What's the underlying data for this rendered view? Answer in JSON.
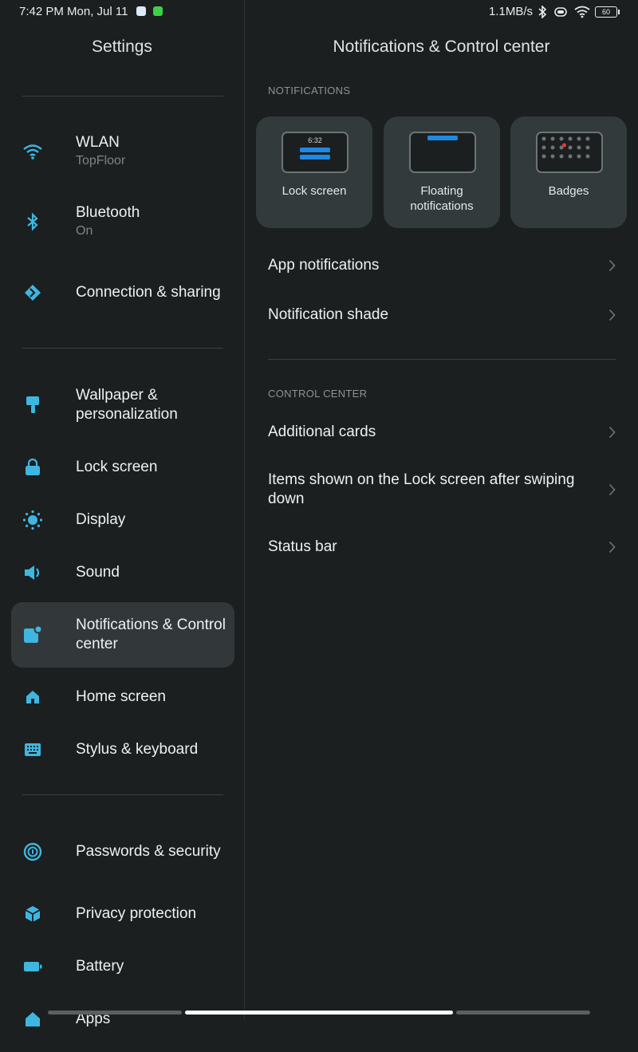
{
  "status_bar": {
    "time": "7:42 PM Mon, Jul 11",
    "network_speed": "1.1MB/s",
    "battery_level": "60"
  },
  "left_pane": {
    "title": "Settings",
    "items": [
      {
        "label": "WLAN",
        "sub": "TopFloor",
        "icon": "wifi-icon"
      },
      {
        "label": "Bluetooth",
        "sub": "On",
        "icon": "bluetooth-icon"
      },
      {
        "label": "Connection & sharing",
        "sub": "",
        "icon": "connection-icon"
      },
      {
        "label": "Wallpaper & personalization",
        "sub": "",
        "icon": "paintbrush-icon"
      },
      {
        "label": "Lock screen",
        "sub": "",
        "icon": "lock-icon"
      },
      {
        "label": "Display",
        "sub": "",
        "icon": "brightness-icon"
      },
      {
        "label": "Sound",
        "sub": "",
        "icon": "speaker-icon"
      },
      {
        "label": "Notifications & Control center",
        "sub": "",
        "icon": "notification-icon"
      },
      {
        "label": "Home screen",
        "sub": "",
        "icon": "home-icon"
      },
      {
        "label": "Stylus & keyboard",
        "sub": "",
        "icon": "keyboard-icon"
      },
      {
        "label": "Passwords & security",
        "sub": "",
        "icon": "fingerprint-icon"
      },
      {
        "label": "Privacy protection",
        "sub": "",
        "icon": "privacy-icon"
      },
      {
        "label": "Battery",
        "sub": "",
        "icon": "battery-icon"
      },
      {
        "label": "Apps",
        "sub": "",
        "icon": "apps-icon"
      }
    ]
  },
  "right_pane": {
    "title": "Notifications & Control center",
    "notifications_header": "NOTIFICATIONS",
    "cards": [
      {
        "label": "Lock screen",
        "preview_time": "6:32"
      },
      {
        "label": "Floating notifications"
      },
      {
        "label": "Badges"
      }
    ],
    "notification_rows": [
      {
        "label": "App notifications"
      },
      {
        "label": "Notification shade"
      }
    ],
    "control_center_header": "CONTROL CENTER",
    "control_rows": [
      {
        "label": "Additional cards"
      },
      {
        "label": "Items shown on the Lock screen after swiping down"
      },
      {
        "label": "Status bar"
      }
    ]
  },
  "colors": {
    "background": "#1b1f20",
    "accent": "#3fb6e0",
    "selected_bg": "#323839",
    "card_bg": "#323a3b",
    "preview_blue": "#1e88e5",
    "badge_red": "#e53935"
  }
}
